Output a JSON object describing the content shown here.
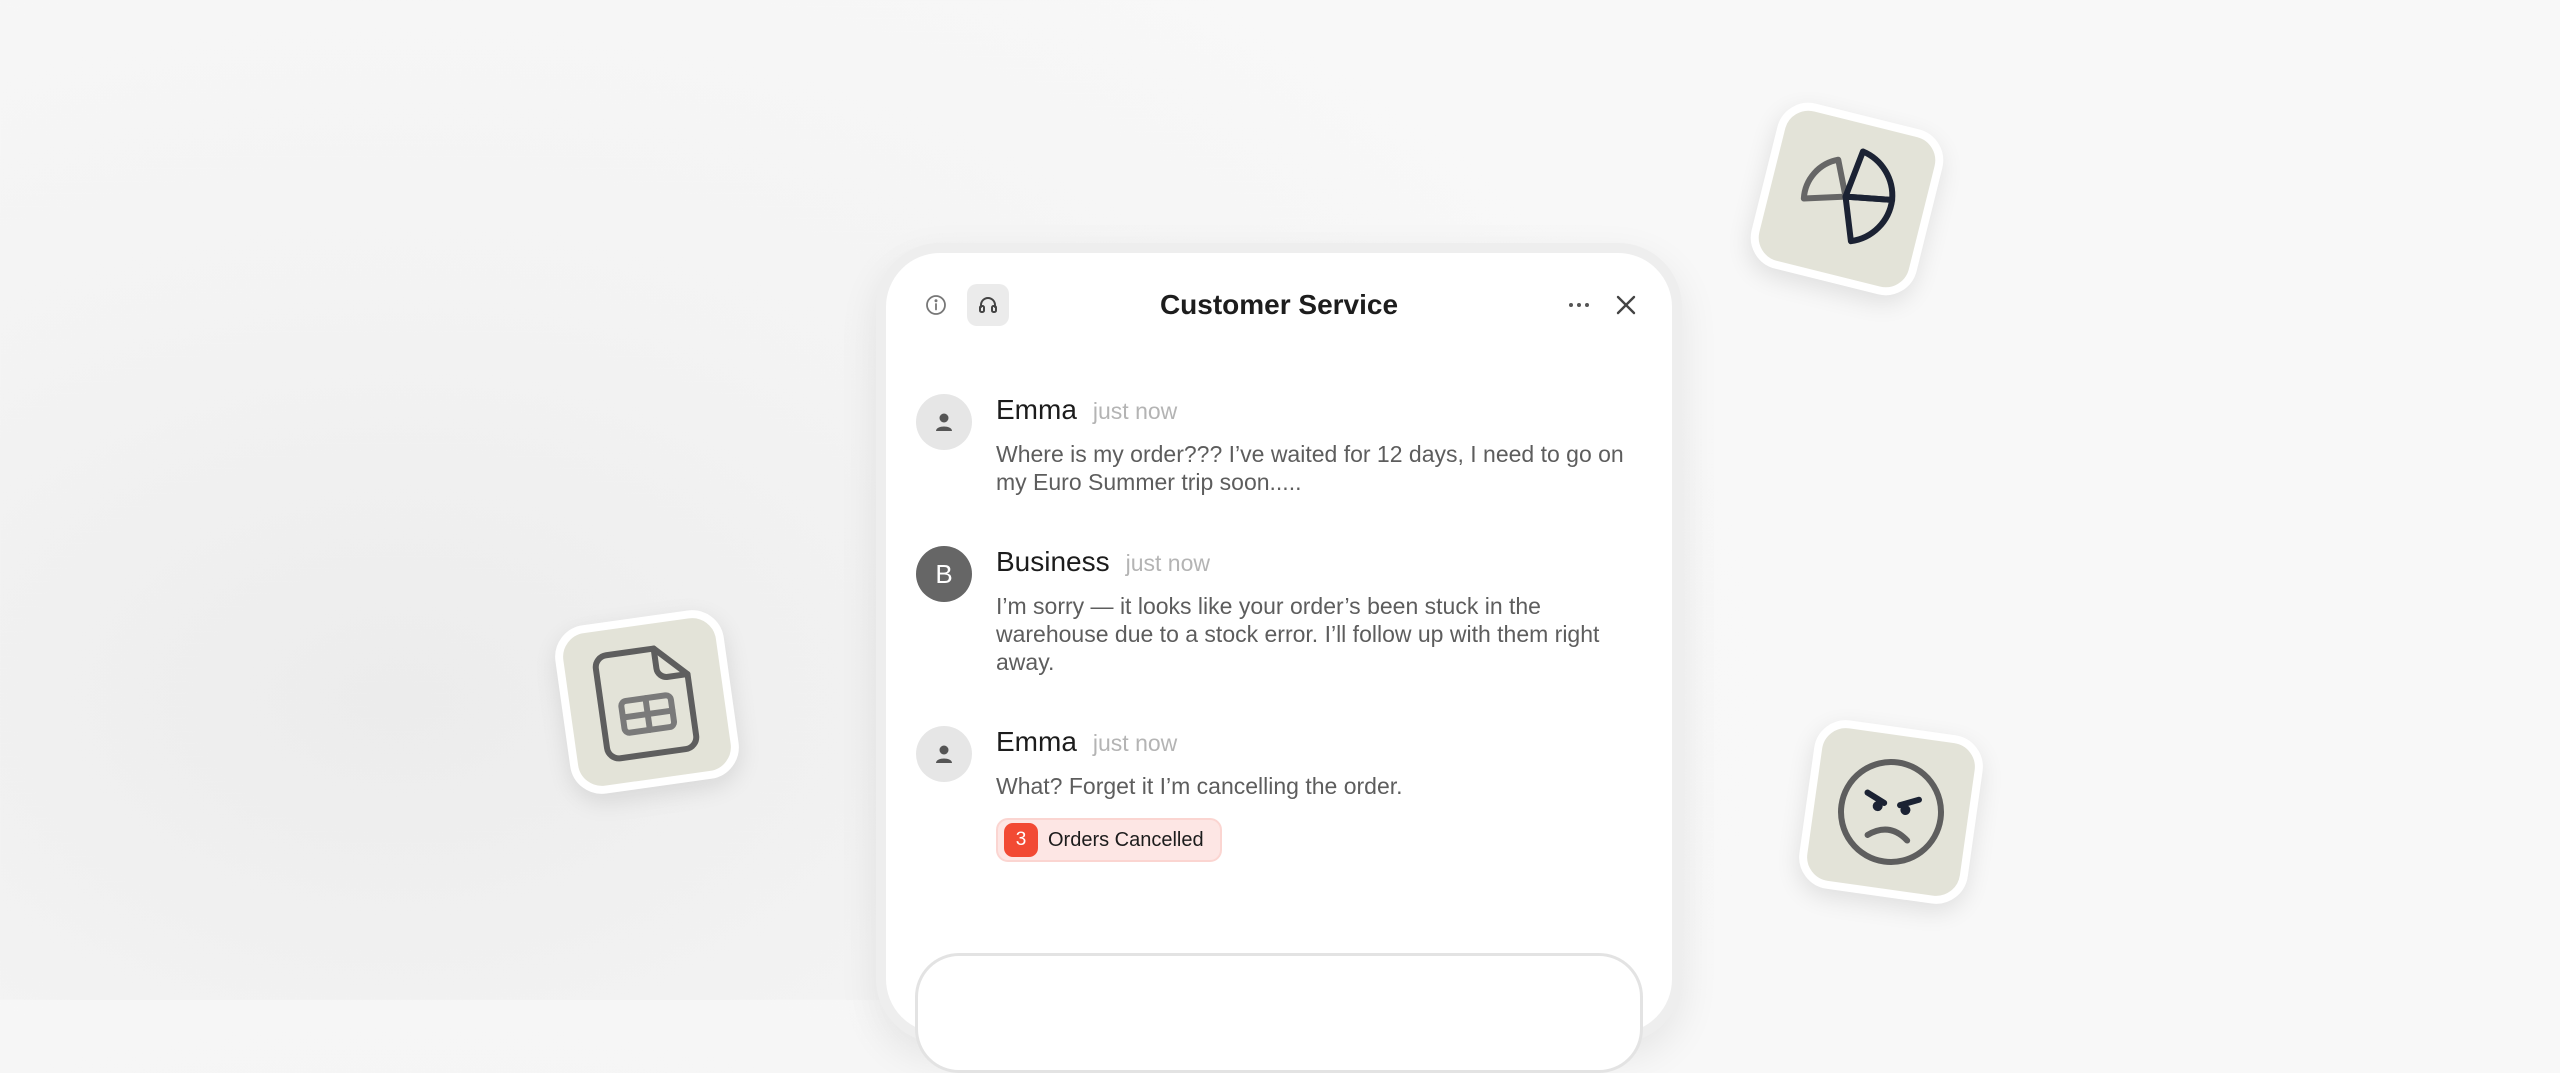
{
  "app": {
    "title": "Customer Service"
  },
  "header": {
    "icons": [
      "info-icon",
      "headset-icon",
      "more-icon",
      "close-icon"
    ]
  },
  "messages": [
    {
      "sender": "Emma",
      "time": "just now",
      "avatar": "user-icon",
      "text": "Where is my order??? I’ve waited for 12 days, I need to go on my Euro Summer trip soon....."
    },
    {
      "sender": "Business",
      "time": "just now",
      "avatar_letter": "B",
      "text": "I’m sorry — it looks like your order’s been stuck in the warehouse due to a stock error. I’ll follow up with them right away."
    },
    {
      "sender": "Emma",
      "time": "just now",
      "avatar": "user-icon",
      "text": "What? Forget it I’m cancelling the order.",
      "badge": {
        "count": "3",
        "label": "Orders Cancelled"
      }
    }
  ],
  "floating_icons": [
    "spreadsheet-icon",
    "pie-chart-icon",
    "angry-face-icon"
  ],
  "colors": {
    "badge_accent": "#f24a34",
    "badge_background": "#fde6e4",
    "tile_background": "#e3e3d8",
    "business_avatar": "#666666"
  }
}
